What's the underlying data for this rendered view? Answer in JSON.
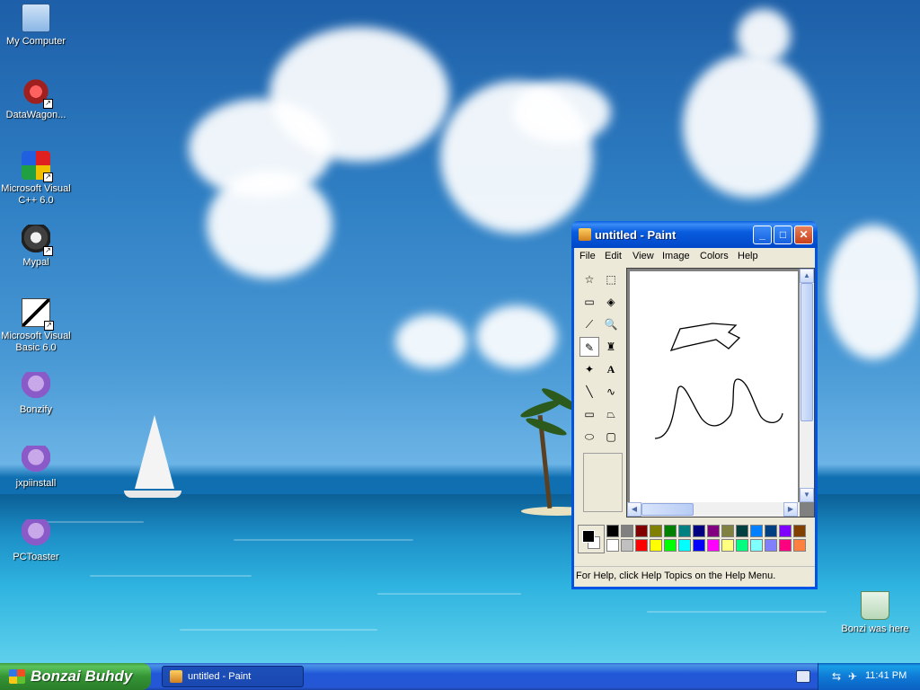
{
  "desktop": {
    "icons": [
      {
        "label": "My Computer",
        "icon": "computer-icon"
      },
      {
        "label": "DataWagon...",
        "icon": "datawagon-icon"
      },
      {
        "label": "Microsoft Visual C++ 6.0",
        "icon": "visual-cpp-icon"
      },
      {
        "label": "Mypal",
        "icon": "mypal-icon"
      },
      {
        "label": "Microsoft Visual Basic 6.0",
        "icon": "visual-basic-icon"
      },
      {
        "label": "Bonzify",
        "icon": "bonzi-icon"
      },
      {
        "label": "jxpiinstall",
        "icon": "bonzi-icon"
      },
      {
        "label": "PCToaster",
        "icon": "bonzi-icon"
      },
      {
        "label": "Bonzi was here",
        "icon": "recycle-bin-icon"
      }
    ]
  },
  "paint": {
    "title": "untitled - Paint",
    "menu": [
      "File",
      "Edit",
      "View",
      "Image",
      "Colors",
      "Help"
    ],
    "tools": [
      "free-form-select",
      "select",
      "eraser",
      "fill-with-color",
      "pick-color",
      "magnifier",
      "pencil",
      "brush",
      "airbrush",
      "text",
      "line",
      "curve",
      "rectangle",
      "polygon",
      "ellipse",
      "rounded-rectangle"
    ],
    "tool_glyphs": {
      "text": "A",
      "line": "╲",
      "curve": "∿",
      "pencil": "✎",
      "magnifier": "🔍",
      "eraser": "▭",
      "fill": "◈",
      "picker": "⟋",
      "brush": "♜",
      "airbrush": "✦"
    },
    "active_tool": "pencil",
    "status": "For Help, click Help Topics on the Help Menu.",
    "colors": {
      "foreground": "#000000",
      "background": "#ffffff",
      "row1": [
        "#000000",
        "#808080",
        "#800000",
        "#808000",
        "#008000",
        "#008080",
        "#000080",
        "#800080",
        "#808040",
        "#004040",
        "#0080ff",
        "#004080",
        "#8000ff",
        "#804000"
      ],
      "row2": [
        "#ffffff",
        "#c0c0c0",
        "#ff0000",
        "#ffff00",
        "#00ff00",
        "#00ffff",
        "#0000ff",
        "#ff00ff",
        "#ffff80",
        "#00ff80",
        "#80ffff",
        "#8080ff",
        "#ff0080",
        "#ff8040"
      ]
    }
  },
  "taskbar": {
    "start_label": "Bonzai Buhdy",
    "task_label": "untitled - Paint",
    "clock": "11:41 PM"
  }
}
